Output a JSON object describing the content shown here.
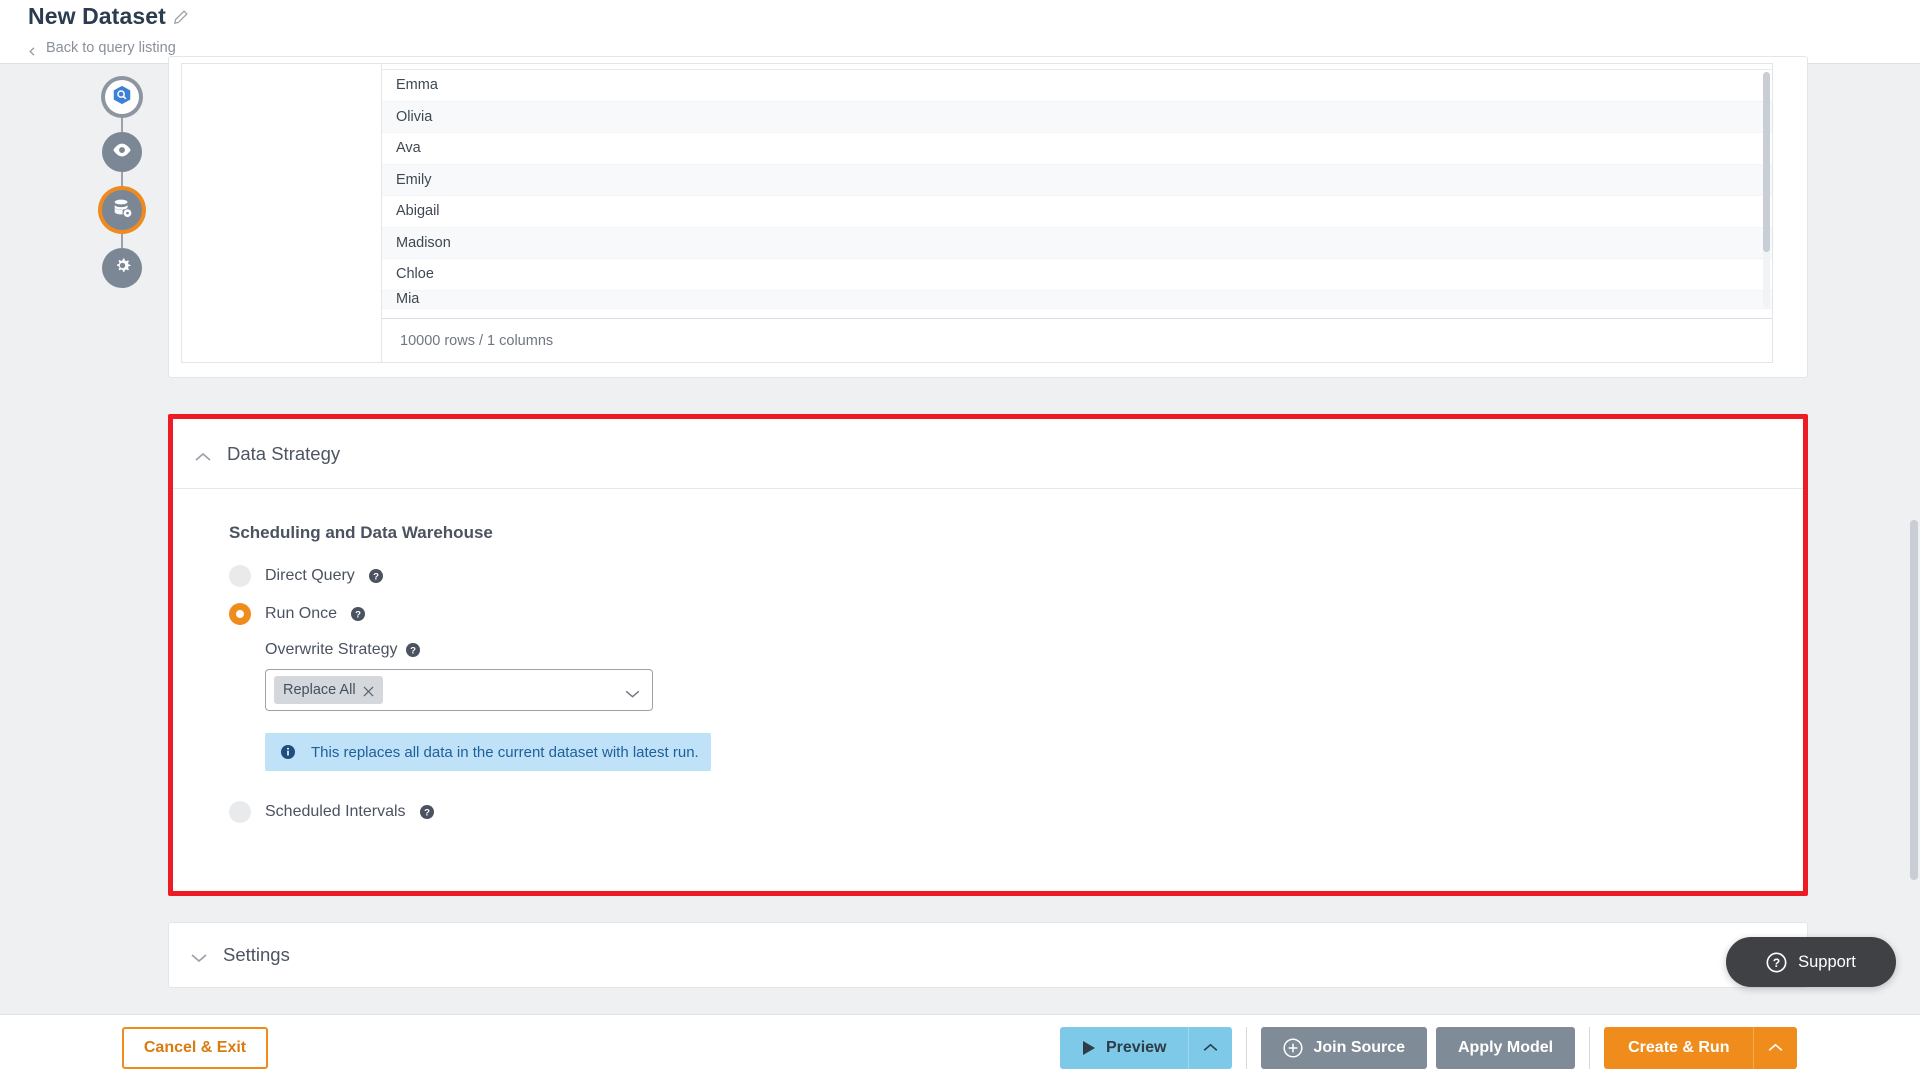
{
  "header": {
    "title": "New Dataset",
    "edit_icon": "pencil-icon",
    "breadcrumb": "Back to query listing"
  },
  "stepper": {
    "items": [
      {
        "name": "query-step",
        "icon": "search-hexagon-icon",
        "state": "complete"
      },
      {
        "name": "preview-step",
        "icon": "eye-icon",
        "state": "complete"
      },
      {
        "name": "data-strategy-step",
        "icon": "database-gear-icon",
        "state": "current"
      },
      {
        "name": "settings-step",
        "icon": "gear-icon",
        "state": "upcoming"
      }
    ]
  },
  "preview": {
    "rows": [
      "Emma",
      "Olivia",
      "Ava",
      "Emily",
      "Abigail",
      "Madison",
      "Chloe",
      "Mia"
    ],
    "footer": "10000 rows / 1 columns"
  },
  "data_strategy": {
    "section_title": "Data Strategy",
    "collapse_icon": "chevron-up-icon",
    "subhead": "Scheduling and Data Warehouse",
    "options": [
      {
        "label": "Direct Query",
        "selected": false,
        "help_icon": "help-circle-icon"
      },
      {
        "label": "Run Once",
        "selected": true,
        "help_icon": "help-circle-icon"
      },
      {
        "label": "Scheduled Intervals",
        "selected": false,
        "help_icon": "help-circle-icon"
      }
    ],
    "overwrite": {
      "label": "Overwrite Strategy",
      "help_icon": "help-circle-icon",
      "chip": "Replace All",
      "chip_remove_icon": "close-icon",
      "dropdown_icon": "chevron-down-icon"
    },
    "info": {
      "icon": "info-circle-icon",
      "text": "This replaces all data in the current dataset with latest run."
    },
    "accent_color": "#f08c1c",
    "highlight_color": "#ed1c24",
    "info_bg": "#bfe2f8",
    "info_text_color": "#1f5f99"
  },
  "settings": {
    "section_title": "Settings",
    "expand_icon": "chevron-down-icon"
  },
  "support": {
    "label": "Support",
    "icon": "help-circle-icon"
  },
  "footer": {
    "cancel": "Cancel & Exit",
    "preview": "Preview",
    "preview_icon": "play-icon",
    "preview_caret_icon": "chevron-up-icon",
    "join_source": "Join Source",
    "join_source_icon": "plus-circle-icon",
    "apply_model": "Apply Model",
    "create_run": "Create & Run",
    "create_run_caret_icon": "chevron-up-icon"
  }
}
